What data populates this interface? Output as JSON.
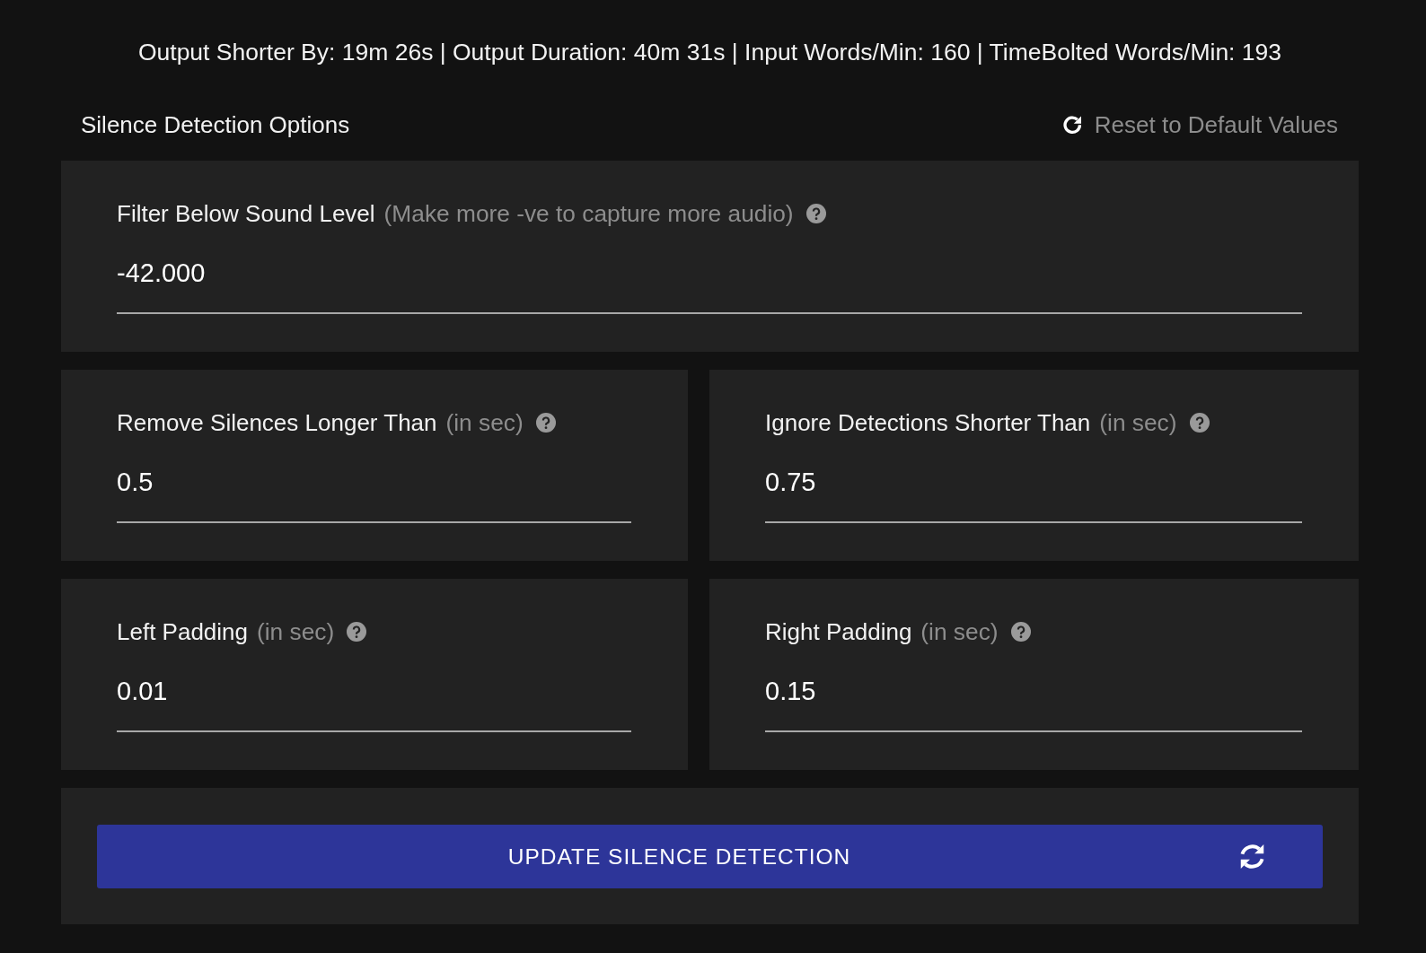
{
  "stats_bar": {
    "text": "Output Shorter By: 19m 26s | Output Duration: 40m 31s | Input Words/Min: 160 | TimeBolted Words/Min: 193"
  },
  "section": {
    "title": "Silence Detection Options",
    "reset_link": "Reset to Default Values"
  },
  "rows": [
    {
      "fields": [
        {
          "label": "Filter Below Sound Level",
          "hint": "(Make more -ve to capture more audio)",
          "value": "-42.000"
        }
      ]
    },
    {
      "fields": [
        {
          "label": "Remove Silences Longer Than",
          "hint": "(in sec)",
          "value": "0.5"
        },
        {
          "label": "Ignore Detections Shorter Than",
          "hint": "(in sec)",
          "value": "0.75"
        }
      ]
    },
    {
      "fields": [
        {
          "label": "Left Padding",
          "hint": "(in sec)",
          "value": "0.01"
        },
        {
          "label": "Right Padding",
          "hint": "(in sec)",
          "value": "0.15"
        }
      ]
    }
  ],
  "update_button": {
    "label": "UPDATE SILENCE DETECTION"
  }
}
